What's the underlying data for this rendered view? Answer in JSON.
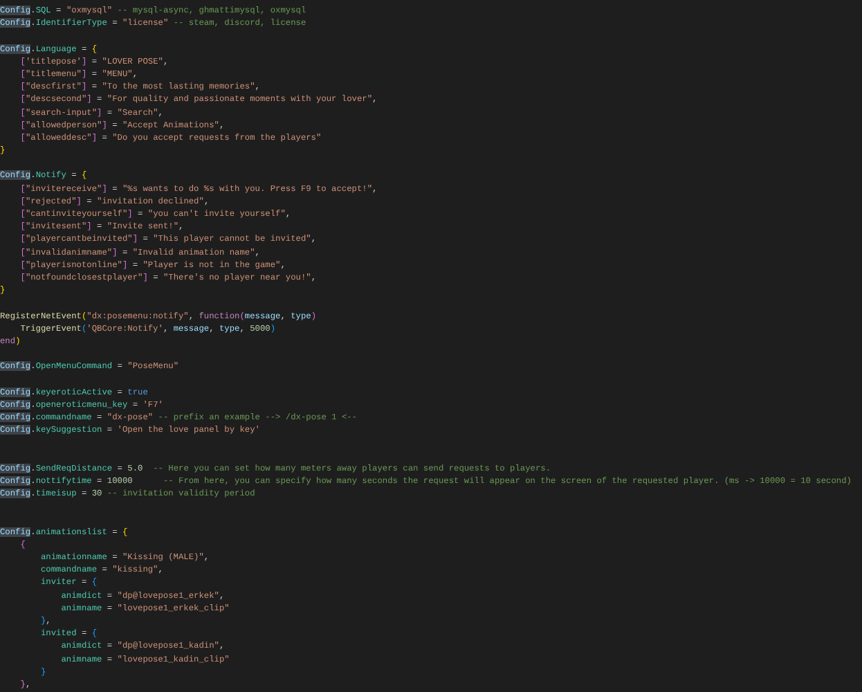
{
  "editor": {
    "lines": [
      {
        "kind": "code",
        "tokens": [
          {
            "kind": "highlight",
            "text": "Config"
          },
          {
            "kind": "plain",
            "text": "."
          },
          {
            "kind": "field",
            "text": "SQL"
          },
          {
            "kind": "plain",
            "text": " = "
          },
          {
            "kind": "string",
            "text": "\"oxmysql\""
          },
          {
            "kind": "comment",
            "text": " -- mysql-async, ghmattimysql, oxmysql"
          }
        ]
      },
      {
        "kind": "code",
        "tokens": [
          {
            "kind": "highlight",
            "text": "Config"
          },
          {
            "kind": "plain",
            "text": "."
          },
          {
            "kind": "field",
            "text": "IdentifierType"
          },
          {
            "kind": "plain",
            "text": " = "
          },
          {
            "kind": "string",
            "text": "\"license\""
          },
          {
            "kind": "comment",
            "text": " -- steam, discord, license"
          }
        ]
      },
      {
        "kind": "blank"
      },
      {
        "kind": "code",
        "tokens": [
          {
            "kind": "highlight",
            "text": "Config"
          },
          {
            "kind": "plain",
            "text": "."
          },
          {
            "kind": "field",
            "text": "Language"
          },
          {
            "kind": "plain",
            "text": " = "
          },
          {
            "kind": "brace1",
            "text": "{"
          }
        ]
      },
      {
        "kind": "code",
        "tokens": [
          {
            "kind": "brace2",
            "text": "    ["
          },
          {
            "kind": "string",
            "text": "'titlepose'"
          },
          {
            "kind": "brace2",
            "text": "]"
          },
          {
            "kind": "plain",
            "text": " = "
          },
          {
            "kind": "string",
            "text": "\"LOVER POSE\""
          },
          {
            "kind": "plain",
            "text": ","
          }
        ]
      },
      {
        "kind": "code",
        "tokens": [
          {
            "kind": "brace2",
            "text": "    ["
          },
          {
            "kind": "string",
            "text": "\"titlemenu\""
          },
          {
            "kind": "brace2",
            "text": "]"
          },
          {
            "kind": "plain",
            "text": " = "
          },
          {
            "kind": "string",
            "text": "\"MENU\""
          },
          {
            "kind": "plain",
            "text": ","
          }
        ]
      },
      {
        "kind": "code",
        "tokens": [
          {
            "kind": "brace2",
            "text": "    ["
          },
          {
            "kind": "string",
            "text": "\"descfirst\""
          },
          {
            "kind": "brace2",
            "text": "]"
          },
          {
            "kind": "plain",
            "text": " = "
          },
          {
            "kind": "string",
            "text": "\"To the most lasting memories\""
          },
          {
            "kind": "plain",
            "text": ","
          }
        ]
      },
      {
        "kind": "code",
        "tokens": [
          {
            "kind": "brace2",
            "text": "    ["
          },
          {
            "kind": "string",
            "text": "\"descsecond\""
          },
          {
            "kind": "brace2",
            "text": "]"
          },
          {
            "kind": "plain",
            "text": " = "
          },
          {
            "kind": "string",
            "text": "\"For quality and passionate moments with your lover\""
          },
          {
            "kind": "plain",
            "text": ","
          }
        ]
      },
      {
        "kind": "code",
        "tokens": [
          {
            "kind": "brace2",
            "text": "    ["
          },
          {
            "kind": "string",
            "text": "\"search-input\""
          },
          {
            "kind": "brace2",
            "text": "]"
          },
          {
            "kind": "plain",
            "text": " = "
          },
          {
            "kind": "string",
            "text": "\"Search\""
          },
          {
            "kind": "plain",
            "text": ","
          }
        ]
      },
      {
        "kind": "code",
        "tokens": [
          {
            "kind": "brace2",
            "text": "    ["
          },
          {
            "kind": "string",
            "text": "\"allowedperson\""
          },
          {
            "kind": "brace2",
            "text": "]"
          },
          {
            "kind": "plain",
            "text": " = "
          },
          {
            "kind": "string",
            "text": "\"Accept Animations\""
          },
          {
            "kind": "plain",
            "text": ","
          }
        ]
      },
      {
        "kind": "code",
        "tokens": [
          {
            "kind": "brace2",
            "text": "    ["
          },
          {
            "kind": "string",
            "text": "\"alloweddesc\""
          },
          {
            "kind": "brace2",
            "text": "]"
          },
          {
            "kind": "plain",
            "text": " = "
          },
          {
            "kind": "string",
            "text": "\"Do you accept requests from the players\""
          }
        ]
      },
      {
        "kind": "code",
        "tokens": [
          {
            "kind": "brace1",
            "text": "}"
          }
        ]
      },
      {
        "kind": "blank"
      },
      {
        "kind": "code",
        "tokens": [
          {
            "kind": "highlight",
            "text": "Config"
          },
          {
            "kind": "plain",
            "text": "."
          },
          {
            "kind": "field",
            "text": "Notify"
          },
          {
            "kind": "plain",
            "text": " = "
          },
          {
            "kind": "brace1",
            "text": "{"
          }
        ]
      },
      {
        "kind": "code",
        "tokens": [
          {
            "kind": "brace2",
            "text": "    ["
          },
          {
            "kind": "string",
            "text": "\"invitereceive\""
          },
          {
            "kind": "brace2",
            "text": "]"
          },
          {
            "kind": "plain",
            "text": " = "
          },
          {
            "kind": "string",
            "text": "\"%s wants to do %s with you. Press F9 to accept!\""
          },
          {
            "kind": "plain",
            "text": ","
          }
        ]
      },
      {
        "kind": "code",
        "tokens": [
          {
            "kind": "brace2",
            "text": "    ["
          },
          {
            "kind": "string",
            "text": "\"rejected\""
          },
          {
            "kind": "brace2",
            "text": "]"
          },
          {
            "kind": "plain",
            "text": " = "
          },
          {
            "kind": "string",
            "text": "\"invitation declined\""
          },
          {
            "kind": "plain",
            "text": ","
          }
        ]
      },
      {
        "kind": "code",
        "tokens": [
          {
            "kind": "brace2",
            "text": "    ["
          },
          {
            "kind": "string",
            "text": "\"cantinviteyourself\""
          },
          {
            "kind": "brace2",
            "text": "]"
          },
          {
            "kind": "plain",
            "text": " = "
          },
          {
            "kind": "string",
            "text": "\"you can't invite yourself\""
          },
          {
            "kind": "plain",
            "text": ","
          }
        ]
      },
      {
        "kind": "code",
        "tokens": [
          {
            "kind": "brace2",
            "text": "    ["
          },
          {
            "kind": "string",
            "text": "\"invitesent\""
          },
          {
            "kind": "brace2",
            "text": "]"
          },
          {
            "kind": "plain",
            "text": " = "
          },
          {
            "kind": "string",
            "text": "\"Invite sent!\""
          },
          {
            "kind": "plain",
            "text": ","
          }
        ]
      },
      {
        "kind": "code",
        "tokens": [
          {
            "kind": "brace2",
            "text": "    ["
          },
          {
            "kind": "string",
            "text": "\"playercantbeinvited\""
          },
          {
            "kind": "brace2",
            "text": "]"
          },
          {
            "kind": "plain",
            "text": " = "
          },
          {
            "kind": "string",
            "text": "\"This player cannot be invited\""
          },
          {
            "kind": "plain",
            "text": ","
          }
        ]
      },
      {
        "kind": "code",
        "tokens": [
          {
            "kind": "brace2",
            "text": "    ["
          },
          {
            "kind": "string",
            "text": "\"invalidanimname\""
          },
          {
            "kind": "brace2",
            "text": "]"
          },
          {
            "kind": "plain",
            "text": " = "
          },
          {
            "kind": "string",
            "text": "\"Invalid animation name\""
          },
          {
            "kind": "plain",
            "text": ","
          }
        ]
      },
      {
        "kind": "code",
        "tokens": [
          {
            "kind": "brace2",
            "text": "    ["
          },
          {
            "kind": "string",
            "text": "\"playerisnotonline\""
          },
          {
            "kind": "brace2",
            "text": "]"
          },
          {
            "kind": "plain",
            "text": " = "
          },
          {
            "kind": "string",
            "text": "\"Player is not in the game\""
          },
          {
            "kind": "plain",
            "text": ","
          }
        ]
      },
      {
        "kind": "code",
        "tokens": [
          {
            "kind": "brace2",
            "text": "    ["
          },
          {
            "kind": "string",
            "text": "\"notfoundclosestplayer\""
          },
          {
            "kind": "brace2",
            "text": "]"
          },
          {
            "kind": "plain",
            "text": " = "
          },
          {
            "kind": "string",
            "text": "\"There's no player near you!\""
          },
          {
            "kind": "plain",
            "text": ","
          }
        ]
      },
      {
        "kind": "code",
        "tokens": [
          {
            "kind": "brace1",
            "text": "}"
          }
        ]
      },
      {
        "kind": "blank"
      },
      {
        "kind": "code",
        "tokens": [
          {
            "kind": "func",
            "text": "RegisterNetEvent"
          },
          {
            "kind": "brace1",
            "text": "("
          },
          {
            "kind": "string",
            "text": "\"dx:posemenu:notify\""
          },
          {
            "kind": "plain",
            "text": ", "
          },
          {
            "kind": "keyword",
            "text": "function"
          },
          {
            "kind": "brace2",
            "text": "("
          },
          {
            "kind": "param",
            "text": "message"
          },
          {
            "kind": "plain",
            "text": ", "
          },
          {
            "kind": "param",
            "text": "type"
          },
          {
            "kind": "brace2",
            "text": ")"
          }
        ]
      },
      {
        "kind": "code",
        "tokens": [
          {
            "kind": "func",
            "text": "    TriggerEvent"
          },
          {
            "kind": "brace3",
            "text": "("
          },
          {
            "kind": "string",
            "text": "'QBCore:Notify'"
          },
          {
            "kind": "plain",
            "text": ", "
          },
          {
            "kind": "param",
            "text": "message"
          },
          {
            "kind": "plain",
            "text": ", "
          },
          {
            "kind": "param",
            "text": "type"
          },
          {
            "kind": "plain",
            "text": ", "
          },
          {
            "kind": "number",
            "text": "5000"
          },
          {
            "kind": "brace3",
            "text": ")"
          }
        ]
      },
      {
        "kind": "code",
        "tokens": [
          {
            "kind": "keyword",
            "text": "end"
          },
          {
            "kind": "brace1",
            "text": ")"
          }
        ]
      },
      {
        "kind": "blank"
      },
      {
        "kind": "code",
        "tokens": [
          {
            "kind": "highlight",
            "text": "Config"
          },
          {
            "kind": "plain",
            "text": "."
          },
          {
            "kind": "field",
            "text": "OpenMenuCommand"
          },
          {
            "kind": "plain",
            "text": " = "
          },
          {
            "kind": "string",
            "text": "\"PoseMenu\""
          }
        ]
      },
      {
        "kind": "blank"
      },
      {
        "kind": "code",
        "tokens": [
          {
            "kind": "highlight",
            "text": "Config"
          },
          {
            "kind": "plain",
            "text": "."
          },
          {
            "kind": "field",
            "text": "keyeroticActive"
          },
          {
            "kind": "plain",
            "text": " = "
          },
          {
            "kind": "bool",
            "text": "true"
          }
        ]
      },
      {
        "kind": "code",
        "tokens": [
          {
            "kind": "highlight",
            "text": "Config"
          },
          {
            "kind": "plain",
            "text": "."
          },
          {
            "kind": "field",
            "text": "openeroticmenu_key"
          },
          {
            "kind": "plain",
            "text": " = "
          },
          {
            "kind": "string",
            "text": "'F7'"
          }
        ]
      },
      {
        "kind": "code",
        "tokens": [
          {
            "kind": "highlight",
            "text": "Config"
          },
          {
            "kind": "plain",
            "text": "."
          },
          {
            "kind": "field",
            "text": "commandname"
          },
          {
            "kind": "plain",
            "text": " = "
          },
          {
            "kind": "string",
            "text": "\"dx-pose\""
          },
          {
            "kind": "comment",
            "text": " -- prefix an example --> /dx-pose 1 <--"
          }
        ]
      },
      {
        "kind": "code",
        "tokens": [
          {
            "kind": "highlight",
            "text": "Config"
          },
          {
            "kind": "plain",
            "text": "."
          },
          {
            "kind": "field",
            "text": "keySuggestion"
          },
          {
            "kind": "plain",
            "text": " = "
          },
          {
            "kind": "string",
            "text": "'Open the love panel by key'"
          }
        ]
      },
      {
        "kind": "blank"
      },
      {
        "kind": "blank"
      },
      {
        "kind": "code",
        "tokens": [
          {
            "kind": "highlight",
            "text": "Config"
          },
          {
            "kind": "plain",
            "text": "."
          },
          {
            "kind": "field",
            "text": "SendReqDistance"
          },
          {
            "kind": "plain",
            "text": " = "
          },
          {
            "kind": "number",
            "text": "5.0"
          },
          {
            "kind": "comment",
            "text": "  -- Here you can set how many meters away players can send requests to players."
          }
        ]
      },
      {
        "kind": "code",
        "tokens": [
          {
            "kind": "highlight",
            "text": "Config"
          },
          {
            "kind": "plain",
            "text": "."
          },
          {
            "kind": "field",
            "text": "nottifytime"
          },
          {
            "kind": "plain",
            "text": " = "
          },
          {
            "kind": "number",
            "text": "10000"
          },
          {
            "kind": "comment",
            "text": "      -- From here, you can specify how many seconds the request will appear on the screen of the requested player. (ms -> 10000 = 10 second)"
          }
        ]
      },
      {
        "kind": "code",
        "tokens": [
          {
            "kind": "highlight",
            "text": "Config"
          },
          {
            "kind": "plain",
            "text": "."
          },
          {
            "kind": "field",
            "text": "timeisup"
          },
          {
            "kind": "plain",
            "text": " = "
          },
          {
            "kind": "number",
            "text": "30"
          },
          {
            "kind": "comment",
            "text": " -- invitation validity period"
          }
        ]
      },
      {
        "kind": "blank"
      },
      {
        "kind": "blank"
      },
      {
        "kind": "code",
        "tokens": [
          {
            "kind": "highlight",
            "text": "Config"
          },
          {
            "kind": "plain",
            "text": "."
          },
          {
            "kind": "field",
            "text": "animationslist"
          },
          {
            "kind": "plain",
            "text": " = "
          },
          {
            "kind": "brace1",
            "text": "{"
          }
        ]
      },
      {
        "kind": "code",
        "tokens": [
          {
            "kind": "brace2",
            "text": "    {"
          }
        ]
      },
      {
        "kind": "code",
        "tokens": [
          {
            "kind": "field",
            "text": "        animationname"
          },
          {
            "kind": "plain",
            "text": " = "
          },
          {
            "kind": "string",
            "text": "\"Kissing (MALE)\""
          },
          {
            "kind": "plain",
            "text": ","
          }
        ]
      },
      {
        "kind": "code",
        "tokens": [
          {
            "kind": "field",
            "text": "        commandname"
          },
          {
            "kind": "plain",
            "text": " = "
          },
          {
            "kind": "string",
            "text": "\"kissing\""
          },
          {
            "kind": "plain",
            "text": ","
          }
        ]
      },
      {
        "kind": "code",
        "tokens": [
          {
            "kind": "field",
            "text": "        inviter"
          },
          {
            "kind": "plain",
            "text": " = "
          },
          {
            "kind": "brace3",
            "text": "{"
          }
        ]
      },
      {
        "kind": "code",
        "tokens": [
          {
            "kind": "field",
            "text": "            animdict"
          },
          {
            "kind": "plain",
            "text": " = "
          },
          {
            "kind": "string",
            "text": "\"dp@lovepose1_erkek\""
          },
          {
            "kind": "plain",
            "text": ","
          }
        ]
      },
      {
        "kind": "code",
        "tokens": [
          {
            "kind": "field",
            "text": "            animname"
          },
          {
            "kind": "plain",
            "text": " = "
          },
          {
            "kind": "string",
            "text": "\"lovepose1_erkek_clip\""
          }
        ]
      },
      {
        "kind": "code",
        "tokens": [
          {
            "kind": "brace3",
            "text": "        }"
          },
          {
            "kind": "plain",
            "text": ","
          }
        ]
      },
      {
        "kind": "code",
        "tokens": [
          {
            "kind": "field",
            "text": "        invited"
          },
          {
            "kind": "plain",
            "text": " = "
          },
          {
            "kind": "brace3",
            "text": "{"
          }
        ]
      },
      {
        "kind": "code",
        "tokens": [
          {
            "kind": "field",
            "text": "            animdict"
          },
          {
            "kind": "plain",
            "text": " = "
          },
          {
            "kind": "string",
            "text": "\"dp@lovepose1_kadin\""
          },
          {
            "kind": "plain",
            "text": ","
          }
        ]
      },
      {
        "kind": "code",
        "tokens": [
          {
            "kind": "field",
            "text": "            animname"
          },
          {
            "kind": "plain",
            "text": " = "
          },
          {
            "kind": "string",
            "text": "\"lovepose1_kadin_clip\""
          }
        ]
      },
      {
        "kind": "code",
        "tokens": [
          {
            "kind": "brace3",
            "text": "        }"
          }
        ]
      },
      {
        "kind": "code",
        "tokens": [
          {
            "kind": "brace2",
            "text": "    }"
          },
          {
            "kind": "plain",
            "text": ","
          }
        ]
      }
    ]
  }
}
